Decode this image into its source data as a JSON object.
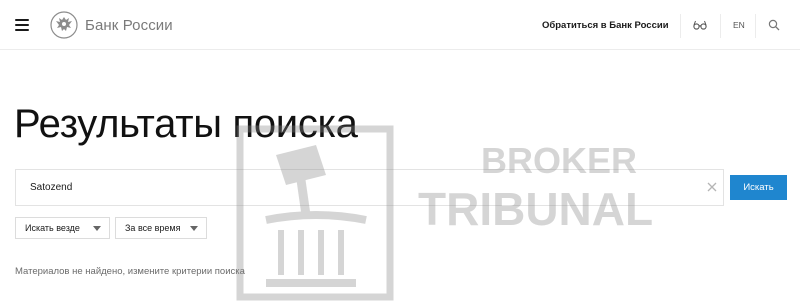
{
  "header": {
    "brand": "Банк России",
    "contact_link": "Обратиться в Банк России",
    "lang": "EN"
  },
  "page_title": "Результаты поиска",
  "search": {
    "value": "Satozend",
    "submit_label": "Искать"
  },
  "filters": {
    "scope": "Искать везде",
    "period": "За все время"
  },
  "empty_message": "Материалов не найдено, измените критерии поиска",
  "watermark": {
    "line1": "BROKER",
    "line2": "TRIBUNAL"
  },
  "colors": {
    "accent": "#1f86cf",
    "text": "#1a1a1a",
    "muted": "#6b6b6b"
  },
  "icons": {
    "menu": "burger-menu-icon",
    "emblem": "double-headed-eagle-icon",
    "accessibility": "glasses-icon",
    "search": "search-icon",
    "clear": "close-icon",
    "dropdown": "chevron-down-icon"
  }
}
